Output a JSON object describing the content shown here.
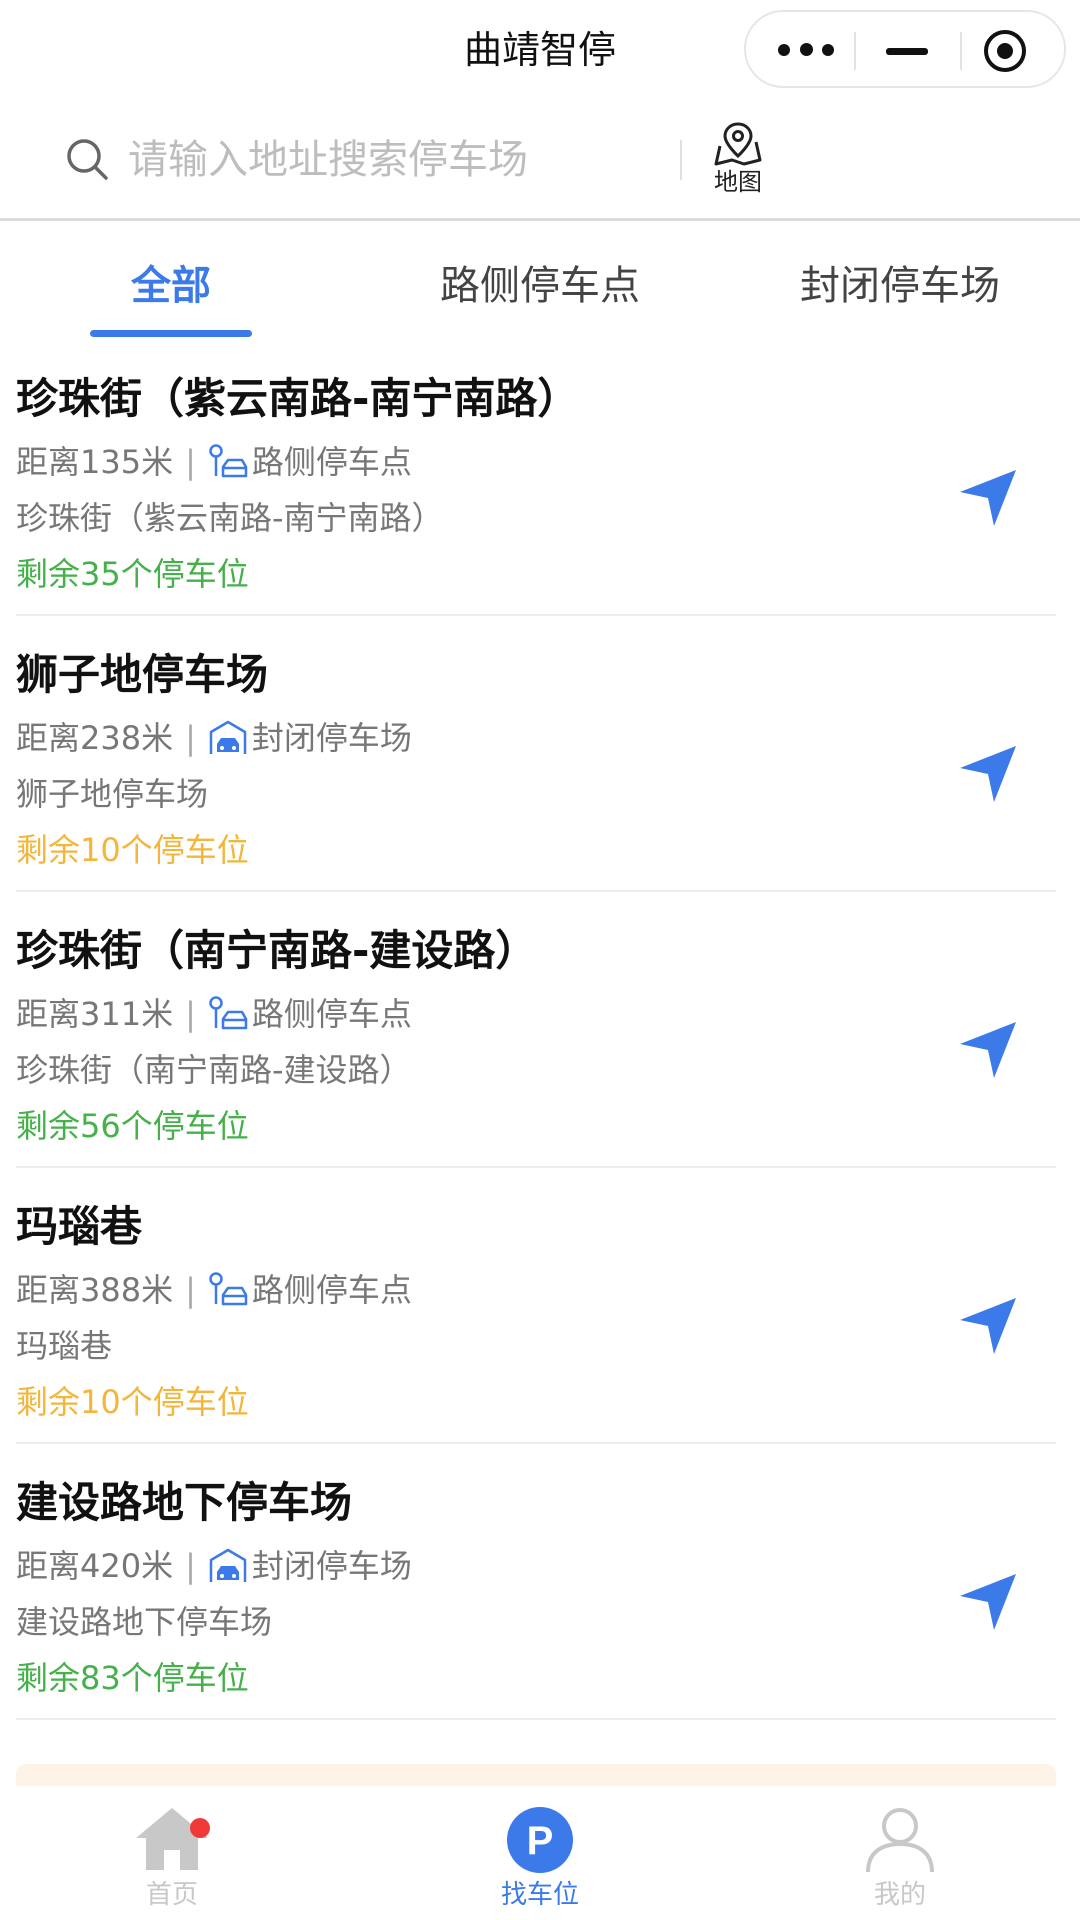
{
  "colors": {
    "accent": "#3b7ae8",
    "available_high": "#46b04a",
    "available_low": "#f3b63b",
    "nav_inactive": "#c8c8c8",
    "badge": "#f03a3a"
  },
  "header": {
    "title": "曲靖智停"
  },
  "search": {
    "placeholder": "请输入地址搜索停车场",
    "value": "",
    "map_label": "地图"
  },
  "tabs": [
    {
      "label": "全部",
      "active": true
    },
    {
      "label": "路侧停车点",
      "active": false
    },
    {
      "label": "封闭停车场",
      "active": false
    }
  ],
  "list": [
    {
      "name": "珍珠街（紫云南路-南宁南路）",
      "distance": "距离135米",
      "type": "路侧停车点",
      "type_icon": "roadside-parking-icon",
      "address": "珍珠街（紫云南路-南宁南路）",
      "remaining": "剩余35个停车位",
      "level": "high"
    },
    {
      "name": "狮子地停车场",
      "distance": "距离238米",
      "type": "封闭停车场",
      "type_icon": "enclosed-parking-icon",
      "address": "狮子地停车场",
      "remaining": "剩余10个停车位",
      "level": "low"
    },
    {
      "name": "珍珠街（南宁南路-建设路）",
      "distance": "距离311米",
      "type": "路侧停车点",
      "type_icon": "roadside-parking-icon",
      "address": "珍珠街（南宁南路-建设路）",
      "remaining": "剩余56个停车位",
      "level": "high"
    },
    {
      "name": "玛瑙巷",
      "distance": "距离388米",
      "type": "路侧停车点",
      "type_icon": "roadside-parking-icon",
      "address": "玛瑙巷",
      "remaining": "剩余10个停车位",
      "level": "low"
    },
    {
      "name": "建设路地下停车场",
      "distance": "距离420米",
      "type": "封闭停车场",
      "type_icon": "enclosed-parking-icon",
      "address": "建设路地下停车场",
      "remaining": "剩余83个停车位",
      "level": "high"
    }
  ],
  "meta_divider": "|",
  "bottom_nav": [
    {
      "label": "首页",
      "icon": "home-icon",
      "active": false,
      "badge": true
    },
    {
      "label": "找车位",
      "icon": "parking-p-icon",
      "active": true,
      "badge": false
    },
    {
      "label": "我的",
      "icon": "user-icon",
      "active": false,
      "badge": false
    }
  ],
  "parking_icon_letter": "P"
}
